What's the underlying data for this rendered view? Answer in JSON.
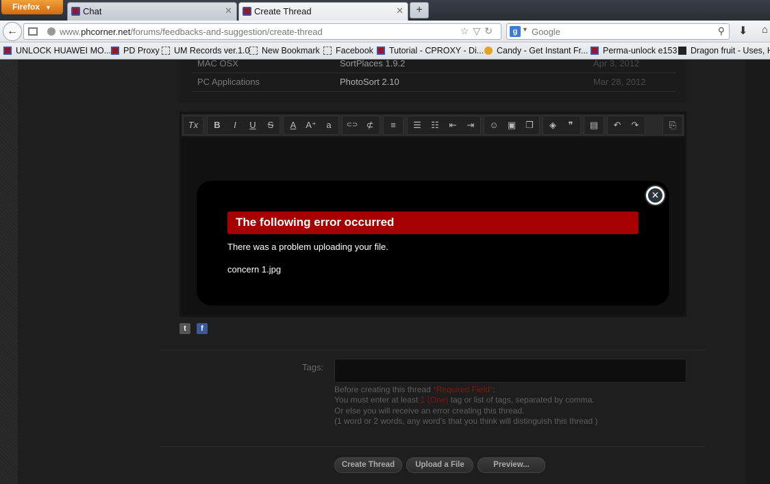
{
  "browser": {
    "menu_label": "Firefox",
    "tabs": [
      {
        "label": "Chat"
      },
      {
        "label": "Create Thread"
      }
    ],
    "url_prefix": "www.",
    "url_domain": "phcorner.net",
    "url_path": "/forums/feedbacks-and-suggestion/create-thread",
    "search_placeholder": "Google",
    "bookmarks": [
      {
        "label": "UNLOCK HUAWEI MO...",
        "icon": "phcorner-icon"
      },
      {
        "label": "PD Proxy",
        "icon": "phcorner-icon"
      },
      {
        "label": "UM Records ver.1.0",
        "icon": "blank-page-icon"
      },
      {
        "label": "New Bookmark",
        "icon": "blank-page-icon"
      },
      {
        "label": "Facebook",
        "icon": "blank-page-icon"
      },
      {
        "label": "Tutorial - CPROXY - Di...",
        "icon": "phcorner-icon"
      },
      {
        "label": "Candy - Get Instant Fr...",
        "icon": "candy-icon"
      },
      {
        "label": "Perma-unlock e153",
        "icon": "phcorner-icon"
      },
      {
        "label": "Dragon fruit - Uses, H",
        "icon": "dragon-icon"
      }
    ]
  },
  "table": {
    "rows": [
      {
        "category": "MAC OSX",
        "title": "SortPlaces 1.9.2",
        "date": "Apr 3, 2012"
      },
      {
        "category": "PC Applications",
        "title": "PhotoSort 2.10",
        "date": "Mar 28, 2012"
      }
    ]
  },
  "toolbar_icons": [
    "remove-format-icon",
    "bold-icon",
    "italic-icon",
    "underline-icon",
    "strikethrough-icon",
    "text-color-icon",
    "font-size-icon",
    "font-family-icon",
    "link-icon",
    "unlink-icon",
    "align-icon",
    "bullet-list-icon",
    "numbered-list-icon",
    "outdent-icon",
    "indent-icon",
    "smilie-icon",
    "image-icon",
    "media-icon",
    "remove-icon",
    "quote-icon",
    "save-draft-icon",
    "undo-icon",
    "redo-icon",
    "toggle-source-icon"
  ],
  "toolbar_glyphs": {
    "remove": "Tx",
    "bold": "B",
    "italic": "I",
    "underline": "U",
    "strike": "S",
    "color": "A",
    "size": "A⁺",
    "font": "a",
    "link": "⊂⊃",
    "unlink": "⊄",
    "align": "≡",
    "bullets": "☰",
    "numbers": "☷",
    "outdent": "⇤",
    "indent": "⇥",
    "smilie": "☺",
    "image": "▣",
    "media": "❐",
    "remove_fmt": "◈",
    "quote": "❞",
    "save": "▤",
    "undo": "↶",
    "redo": "↷",
    "source": "⎘"
  },
  "modal": {
    "title": "The following error occurred",
    "message": "There was a problem uploading your file.",
    "filename": "concern 1.jpg",
    "close_glyph": "×"
  },
  "tags": {
    "label": "Tags:",
    "hint_line1_prefix": "Before creating this thread ",
    "hint_required": "*Required Field*",
    "hint_line1_suffix": ":",
    "hint_line2_prefix": "You must enter at least ",
    "hint_line2_emph": "1 (One)",
    "hint_line2_suffix": " tag or list of tags, separated by comma.",
    "hint_line3": "Or else you will receive an error creating this thread.",
    "hint_line4": "(1 word or 2 words, any word's that you think will distinguish this thread )"
  },
  "buttons": {
    "create": "Create Thread",
    "upload": "Upload a File",
    "preview": "Preview..."
  },
  "social": {
    "twitter_glyph": "t",
    "facebook_glyph": "f"
  },
  "colors": {
    "error_red": "#a60000",
    "required_red": "#8a1010"
  }
}
